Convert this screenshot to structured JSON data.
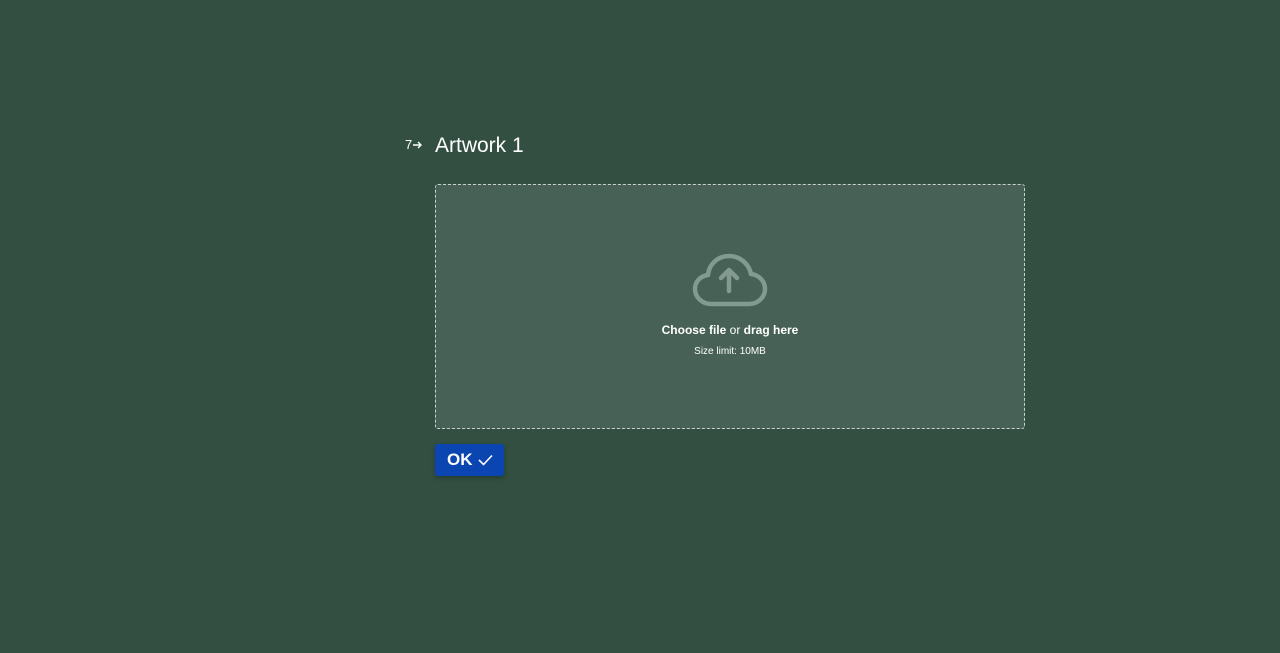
{
  "question": {
    "number": "7",
    "number_arrow_icon": "arrow-right-icon",
    "title": "Artwork 1"
  },
  "upload": {
    "icon": "cloud-upload-icon",
    "choose_label": "Choose file",
    "or_label": "or",
    "drag_label": "drag here",
    "size_limit": "Size limit: 10MB"
  },
  "ok_button": {
    "label": "OK",
    "icon": "check-icon",
    "color": "#0a45b2"
  },
  "colors": {
    "background": "#324f41",
    "dropzone": "#476156"
  }
}
